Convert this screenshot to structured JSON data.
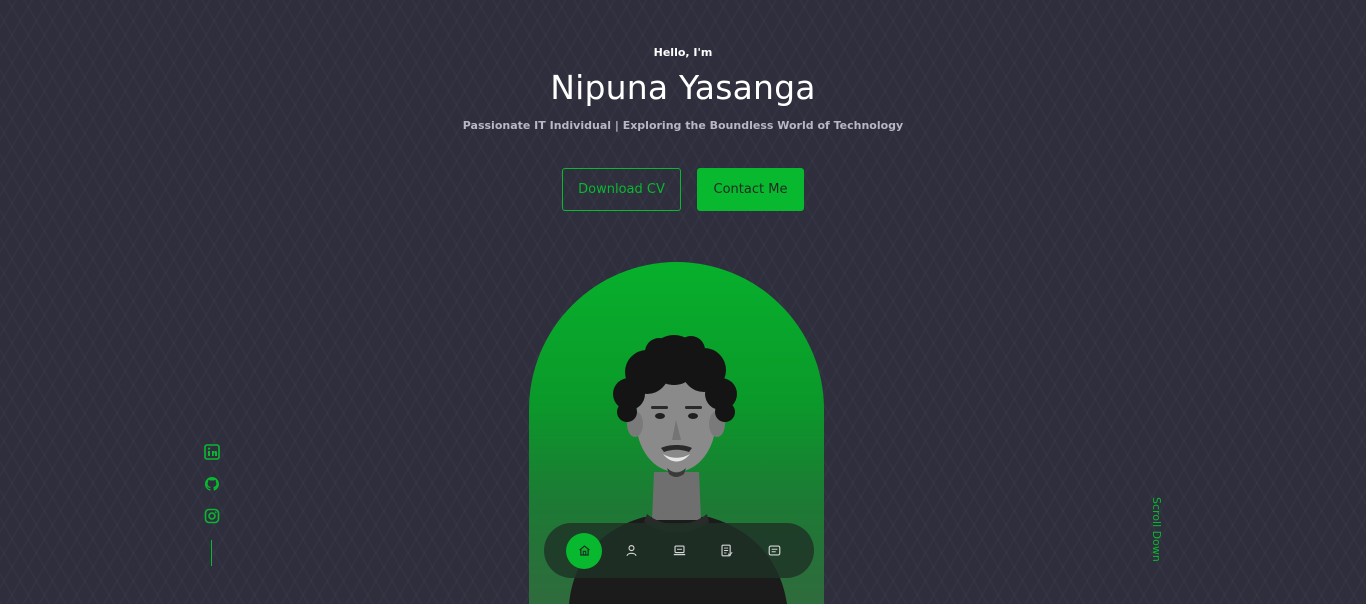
{
  "hero": {
    "greeting": "Hello, I'm",
    "name": "Nipuna Yasanga",
    "tagline": "Passionate IT Individual | Exploring the Boundless World of Technology",
    "download_label": "Download CV",
    "contact_label": "Contact Me"
  },
  "socials": [
    {
      "icon": "linkedin-icon"
    },
    {
      "icon": "github-icon"
    },
    {
      "icon": "instagram-icon"
    }
  ],
  "scroll_label": "Scroll Down",
  "nav": [
    {
      "icon": "home-icon",
      "active": true
    },
    {
      "icon": "user-icon",
      "active": false
    },
    {
      "icon": "laptop-icon",
      "active": false
    },
    {
      "icon": "notes-icon",
      "active": false
    },
    {
      "icon": "message-icon",
      "active": false
    }
  ],
  "colors": {
    "accent": "#08b82f",
    "background": "#2f2e3c",
    "text": "#ffffff",
    "muted": "#b9b8c6"
  }
}
